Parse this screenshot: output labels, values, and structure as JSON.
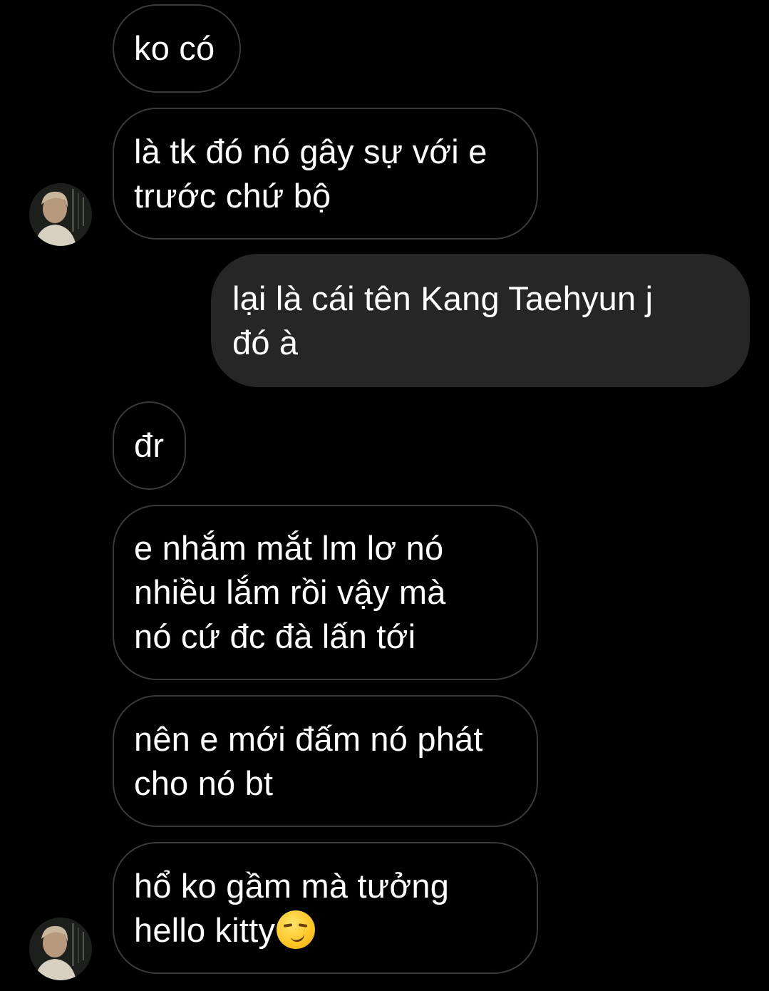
{
  "conversation": {
    "messages": [
      {
        "sender": "other",
        "text": "ko có"
      },
      {
        "sender": "other",
        "text": "là tk đó nó gây sự với e\ntrước chứ bộ"
      },
      {
        "sender": "me",
        "text": "lại là cái tên Kang Taehyun j\nđó à"
      },
      {
        "sender": "other",
        "text": "đr"
      },
      {
        "sender": "other",
        "text": "e nhắm mắt lm lơ nó\nnhiều lắm rồi vậy mà\nnó cứ đc đà lấn tới"
      },
      {
        "sender": "other",
        "text": "nên e mới đấm nó phát\ncho nó bt"
      },
      {
        "sender": "other",
        "text": "hổ ko gầm mà tưởng\nhello kitty",
        "emoji": "smirking-face-emoji"
      }
    ]
  },
  "colors": {
    "background": "#000000",
    "incoming_border": "#3a3a3a",
    "outgoing_fill": "#262626",
    "text": "#ffffff"
  },
  "avatar": {
    "icon": "contact-avatar-photo"
  }
}
